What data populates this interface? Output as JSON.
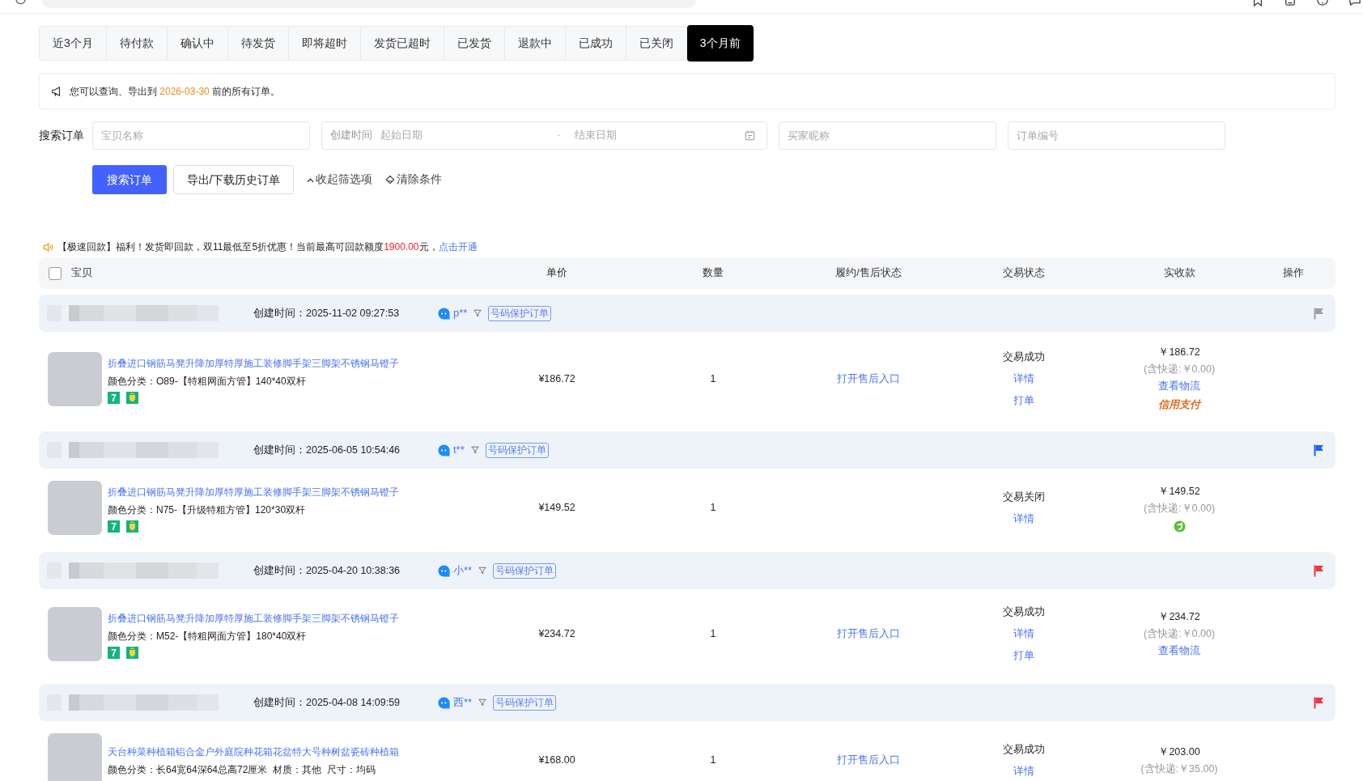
{
  "tabs": [
    {
      "label": "近3个月",
      "selected": false
    },
    {
      "label": "待付款",
      "selected": false
    },
    {
      "label": "确认中",
      "selected": false
    },
    {
      "label": "待发货",
      "selected": false
    },
    {
      "label": "即将超时",
      "selected": false
    },
    {
      "label": "发货已超时",
      "selected": false
    },
    {
      "label": "已发货",
      "selected": false
    },
    {
      "label": "退款中",
      "selected": false
    },
    {
      "label": "已成功",
      "selected": false
    },
    {
      "label": "已关闭",
      "selected": false
    },
    {
      "label": "3个月前",
      "selected": true
    }
  ],
  "notice": {
    "parts": [
      {
        "kind": "plain",
        "text": "您可以查询、导出到 "
      },
      {
        "kind": "date",
        "text": "2026-03-30"
      },
      {
        "kind": "plain",
        "text": " 前的所有订单。"
      }
    ]
  },
  "search": {
    "label": "搜索订单",
    "fields": [
      {
        "kind": "text",
        "placeholder": "宝贝名称"
      },
      {
        "kind": "date_range",
        "prefix": "创建时间",
        "start_placeholder": "起始日期",
        "separator": "-",
        "end_placeholder": "结束日期"
      },
      {
        "kind": "text",
        "placeholder": "买家昵称"
      },
      {
        "kind": "text",
        "placeholder": "订单编号"
      }
    ],
    "buttons": [
      {
        "kind": "primary",
        "label": "搜索订单"
      },
      {
        "kind": "default",
        "label": "导出/下载历史订单"
      }
    ],
    "links": [
      {
        "kind": "collapse",
        "label": "收起筛选项"
      },
      {
        "kind": "clear",
        "label": "清除条件"
      }
    ]
  },
  "promo": {
    "parts": [
      {
        "kind": "plain",
        "text": "【极速回款】福利！发货即回款，双11最低至5折优惠！当前最高可回款额度"
      },
      {
        "kind": "amount",
        "text": "1900.00"
      },
      {
        "kind": "plain",
        "text": "元，"
      },
      {
        "kind": "link",
        "text": "点击开通"
      }
    ]
  },
  "table": {
    "select_all": {
      "checked": false
    },
    "columns": [
      "宝贝",
      "单价",
      "数量",
      "履约/售后状态",
      "交易状态",
      "实收款",
      "操作"
    ]
  },
  "orders": [
    {
      "created": "创建时间：2025-11-02 09:27:53",
      "buyer": "p**",
      "tag": "号码保护订单",
      "flag": {
        "color": "#9e9e9e"
      },
      "item": {
        "title": "折叠进口钢筋马凳升降加厚特厚施工装修脚手架三脚架不锈钢马镫子",
        "variant": "颜色分类：O89-【特粗网面方管】140*40双杆",
        "badges": [
          {
            "kind": "days",
            "text": "7"
          },
          {
            "kind": "guarantee"
          }
        ],
        "price": "¥186.72",
        "quantity": "1",
        "after_sale": "打开售后入口",
        "trade_status": "交易成功",
        "actions": [
          "详情",
          "打单"
        ],
        "amount": "￥186.72",
        "shipping": "(含快递:￥0.00)",
        "logistics": "查看物流",
        "payment_mark": {
          "kind": "credit",
          "label": "信用支付"
        }
      }
    },
    {
      "created": "创建时间：2025-06-05 10:54:46",
      "buyer": "t**",
      "tag": "号码保护订单",
      "flag": {
        "color": "#1a66ff"
      },
      "item": {
        "title": "折叠进口钢筋马凳升降加厚特厚施工装修脚手架三脚架不锈钢马镫子",
        "variant": "颜色分类：N75-【升级特粗方管】120*30双杆",
        "badges": [
          {
            "kind": "days",
            "text": "7"
          },
          {
            "kind": "guarantee"
          }
        ],
        "price": "¥149.52",
        "quantity": "1",
        "trade_status": "交易关闭",
        "actions": [
          "详情"
        ],
        "amount": "￥149.52",
        "shipping": "(含快递:￥0.00)",
        "payment_mark": {
          "kind": "swirl"
        }
      }
    },
    {
      "created": "创建时间：2025-04-20 10:38:36",
      "buyer": "小**",
      "tag": "号码保护订单",
      "flag": {
        "color": "#f0353d"
      },
      "item": {
        "title": "折叠进口钢筋马凳升降加厚特厚施工装修脚手架三脚架不锈钢马镫子",
        "variant": "颜色分类：M52-【特粗网面方管】180*40双杆",
        "badges": [
          {
            "kind": "days",
            "text": "7"
          },
          {
            "kind": "guarantee"
          }
        ],
        "price": "¥234.72",
        "quantity": "1",
        "after_sale": "打开售后入口",
        "trade_status": "交易成功",
        "actions": [
          "详情",
          "打单"
        ],
        "amount": "￥234.72",
        "shipping": "(含快递:￥0.00)",
        "logistics": "查看物流"
      }
    },
    {
      "created": "创建时间：2025-04-08 14:09:59",
      "buyer": "西**",
      "tag": "号码保护订单",
      "flag": {
        "color": "#f0353d"
      },
      "item": {
        "title": "天台种菜种植箱铝合金户外庭院种花箱花盆特大号种树盆瓷砖种植箱",
        "variant": "颜色分类：长64宽64深64总高72厘米  材质：其他  尺寸：均码",
        "price": "¥168.00",
        "quantity": "1",
        "after_sale": "打开售后入口",
        "trade_status": "交易成功",
        "actions": [
          "详情"
        ],
        "amount": "￥203.00",
        "shipping": "(含快递:￥35.00)"
      }
    }
  ]
}
